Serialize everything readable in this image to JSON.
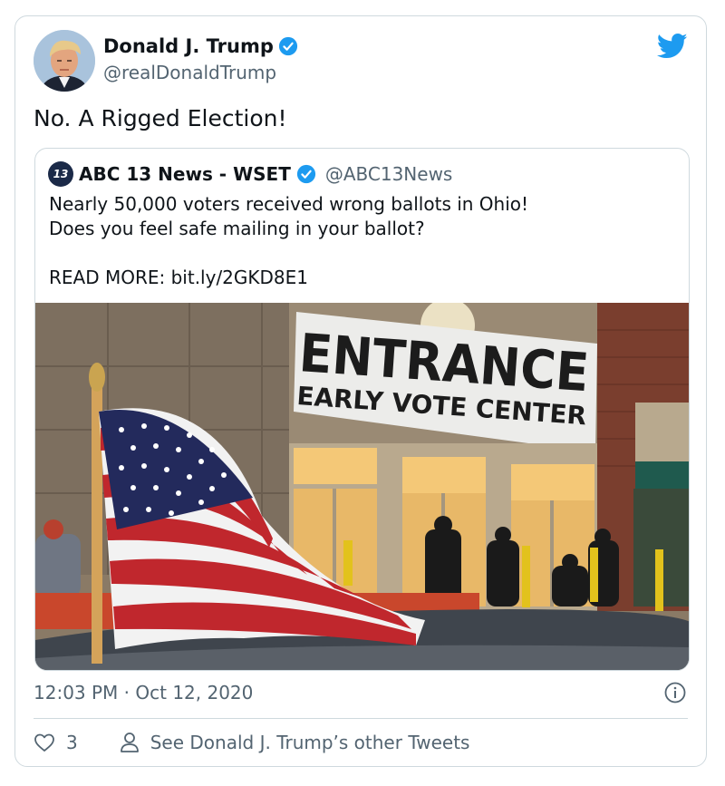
{
  "tweet": {
    "author_name": "Donald J. Trump",
    "author_handle": "@realDonaldTrump",
    "text": "No. A Rigged Election!",
    "timestamp": "12:03 PM · Oct 12, 2020",
    "like_count": "3",
    "other_tweets_label": "See Donald J. Trump’s other Tweets"
  },
  "quote": {
    "avatar_text": "13",
    "author_name": "ABC 13 News - WSET",
    "author_handle": "@ABC13News",
    "lines": [
      "Nearly 50,000 voters received wrong ballots in Ohio!",
      "Does you feel safe mailing in your ballot?",
      "",
      "READ MORE: bit.ly/2GKD8E1"
    ],
    "image": {
      "banner_line1": "ENTRANCE",
      "banner_line2": "EARLY VOTE CENTER"
    }
  },
  "colors": {
    "twitter_blue": "#1d9bf0",
    "text_primary": "#0f1419",
    "text_secondary": "#536471",
    "border": "#cfd9de"
  },
  "icons": {
    "logo": "twitter-bird-icon",
    "verified": "verified-badge-icon",
    "info": "info-icon",
    "like": "heart-icon",
    "profile": "person-icon"
  }
}
